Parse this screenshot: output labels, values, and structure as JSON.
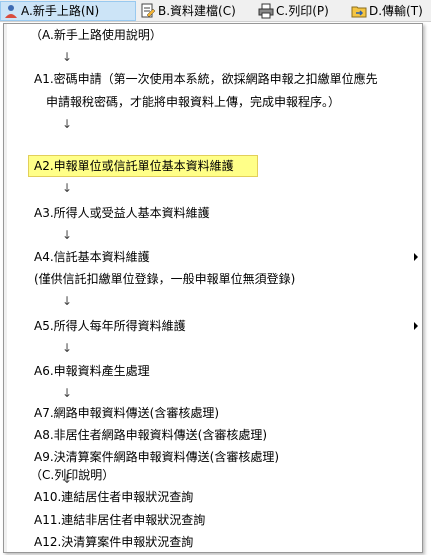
{
  "menubar": {
    "items": [
      {
        "label": "A.新手上路(N)",
        "icon": "person-icon"
      },
      {
        "label": "B.資料建檔(C)",
        "icon": "document-edit-icon"
      },
      {
        "label": "C.列印(P)",
        "icon": "printer-icon"
      },
      {
        "label": "D.傳輸(T)",
        "icon": "folder-transfer-icon"
      }
    ]
  },
  "dropdown": {
    "header_a": "（A.新手上路使用說明）",
    "a1_line1": "A1.密碼申請（第一次使用本系統，欲採網路申報之扣繳單位應先",
    "a1_line2": "申請報稅密碼，才能將申報資料上傳，完成申報程序。）",
    "a2": "A2.申報單位或信託單位基本資料維護",
    "a3": "A3.所得人或受益人基本資料維護",
    "a4": "A4.信託基本資料維護",
    "a4_note": "(僅供信託扣繳單位登錄，一般申報單位無須登錄)",
    "a5": "A5.所得人每年所得資料維護",
    "a6": "A6.申報資料產生處理",
    "a7": "A7.網路申報資料傳送(含審核處理)",
    "a8": "A8.非居住者網路申報資料傳送(含審核處理)",
    "a9": "A9.決清算案件網路申報資料傳送(含審核處理)",
    "header_c": "（C.列印說明）",
    "a10": "A10.連結居住者申報狀況查詢",
    "a11": "A11.連結非居住者申報狀況查詢",
    "a12": "A12.決清算案件申報狀況查詢",
    "flow_arrow": "↓"
  },
  "colors": {
    "highlight": "#ffff88",
    "menu_active": "#cce4f7"
  }
}
